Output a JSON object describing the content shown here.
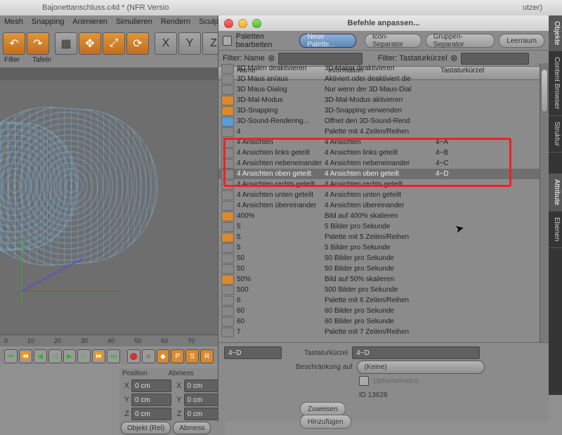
{
  "window": {
    "filename": "Bajonettanschluss.c4d * (NFR Versio",
    "dialog_title": "Befehle anpassen...",
    "user_suffix": "utzer)"
  },
  "menubar": [
    "Mesh",
    "Snapping",
    "Animieren",
    "Simulieren",
    "Rendern",
    "Sculpting"
  ],
  "modebar": [
    "Filter",
    "Tafeln"
  ],
  "dlg": {
    "edit_palettes": "Paletten bearbeiten",
    "new_palette": "Neue Palette...",
    "icon_sep": "Icon-Separator",
    "group_sep": "Gruppen-Separator",
    "space": "Leerraum",
    "filter_name": "Filter: Name",
    "filter_key": "Filter: Tastaturkürzel",
    "cols": {
      "name": "Name",
      "info": "Information",
      "key": "Tastaturkürzel"
    }
  },
  "commands": [
    {
      "icon": "g",
      "name": "3D Malen deaktivieren",
      "info": "3D Malen deaktivieren",
      "key": ""
    },
    {
      "icon": "g",
      "name": "3D Maus an/aus",
      "info": "Aktiviert oder deaktiviert die",
      "key": ""
    },
    {
      "icon": "g",
      "name": "3D Maus-Dialog",
      "info": "Nur wenn der 3D Maus-Dial",
      "key": ""
    },
    {
      "icon": "o",
      "name": "3D-Mal-Modus",
      "info": "3D-Mal-Modus aktivieren",
      "key": ""
    },
    {
      "icon": "o",
      "name": "3D-Snapping",
      "info": "3D-Snapping verwenden",
      "key": ""
    },
    {
      "icon": "b",
      "name": "3D-Sound-Rendering...",
      "info": "Öffnet den 3D-Sound-Rend",
      "key": ""
    },
    {
      "icon": "g",
      "name": "4",
      "info": "Palette mit 4 Zeilen/Reihen",
      "key": ""
    },
    {
      "icon": "g",
      "name": "4 Ansichten",
      "info": "4 Ansichten",
      "key": "4~A",
      "hl": true
    },
    {
      "icon": "g",
      "name": "4 Ansichten links geteilt",
      "info": "4 Ansichten links geteilt",
      "key": "4~B",
      "hl": true
    },
    {
      "icon": "g",
      "name": "4 Ansichten nebeneinander",
      "info": "4 Ansichten nebeneinander",
      "key": "4~C",
      "hl": true
    },
    {
      "icon": "g",
      "name": "4 Ansichten oben geteilt",
      "info": "4 Ansichten oben geteilt",
      "key": "4~D",
      "hl": true,
      "sel": true
    },
    {
      "icon": "g",
      "name": "4 Ansichten rechts geteilt",
      "info": "4 Ansichten rechts geteilt",
      "key": ""
    },
    {
      "icon": "g",
      "name": "4 Ansichten unten geteilt",
      "info": "4 Ansichten unten geteilt",
      "key": ""
    },
    {
      "icon": "g",
      "name": "4 Ansichten übereinander",
      "info": "4 Ansichten übereinander",
      "key": ""
    },
    {
      "icon": "o",
      "name": "400%",
      "info": "Bild auf 400% skalieren",
      "key": ""
    },
    {
      "icon": "g",
      "name": "5",
      "info": "5 Bilder pro Sekunde",
      "key": ""
    },
    {
      "icon": "o",
      "name": "5",
      "info": "Palette mit 5 Zeilen/Reihen",
      "key": ""
    },
    {
      "icon": "g",
      "name": "5",
      "info": "5 Bilder pro Sekunde",
      "key": ""
    },
    {
      "icon": "g",
      "name": "50",
      "info": "50 Bilder pro Sekunde",
      "key": ""
    },
    {
      "icon": "g",
      "name": "50",
      "info": "50 Bilder pro Sekunde",
      "key": ""
    },
    {
      "icon": "o",
      "name": "50%",
      "info": "Bild auf 50% skalieren",
      "key": ""
    },
    {
      "icon": "g",
      "name": "500",
      "info": "500 Bilder pro Sekunde",
      "key": ""
    },
    {
      "icon": "g",
      "name": "6",
      "info": "Palette mit 6 Zeilen/Reihen",
      "key": ""
    },
    {
      "icon": "g",
      "name": "60",
      "info": "60 Bilder pro Sekunde",
      "key": ""
    },
    {
      "icon": "g",
      "name": "60",
      "info": "60 Bilder pro Sekunde",
      "key": ""
    },
    {
      "icon": "g",
      "name": "7",
      "info": "Palette mit 7 Zeilen/Reihen",
      "key": ""
    }
  ],
  "bottom": {
    "shortcut_field": "4~D",
    "shortcut_label": "Tastaturkürzel",
    "shortcut_value": "4~D",
    "restrict_label": "Beschränkung auf",
    "restrict_value": "(Keine)",
    "options_mode": "Optionsmodus",
    "id_label": "ID 13628",
    "assign": "Zuweisen",
    "add": "Hinzufügen"
  },
  "coords": {
    "position": "Position",
    "size": "Abmess",
    "x": "X",
    "y": "Y",
    "z": "Z",
    "val": "0 cm",
    "object_rel": "Objekt (Rel)",
    "size_btn": "Abmess"
  },
  "timeline": {
    "marks": [
      "0",
      "10",
      "20",
      "30",
      "40",
      "50",
      "60",
      "70"
    ]
  },
  "sidetabs": [
    "Objekte",
    "Content Browser",
    "Struktur",
    "Attribute",
    "Ebenen"
  ]
}
